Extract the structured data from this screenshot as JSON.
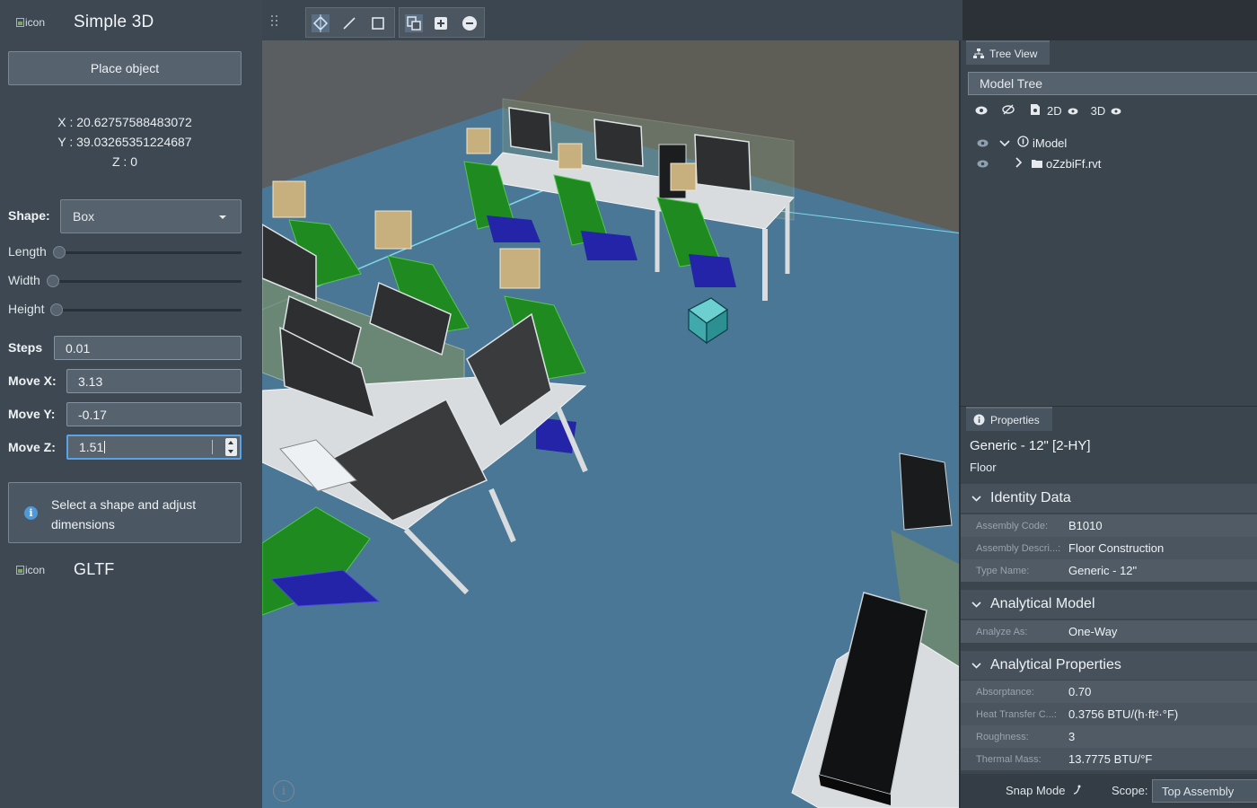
{
  "app": {
    "broken_image_alt": "icon",
    "title": "Simple 3D",
    "gltf_title": "GLTF"
  },
  "left": {
    "place_button": "Place object",
    "coords": {
      "x": "X : 20.62757588483072",
      "y": "Y : 39.03265351224687",
      "z": "Z : 0"
    },
    "shape_label": "Shape:",
    "shape_value": "Box",
    "sliders": [
      {
        "label": "Length",
        "value_fraction": 0
      },
      {
        "label": "Width",
        "value_fraction": 0
      },
      {
        "label": "Height",
        "value_fraction": 0
      }
    ],
    "steps_label": "Steps",
    "steps_value": "0.01",
    "move_x_label": "Move X:",
    "move_x_value": "3.13",
    "move_y_label": "Move Y:",
    "move_y_value": "-0.17",
    "move_z_label": "Move Z:",
    "move_z_value": "1.51",
    "info_message": "Select a shape and adjust dimensions"
  },
  "toolbar": {
    "tools": [
      "select-tool-icon",
      "measure-line-icon",
      "rectangle-icon",
      "copy-icon",
      "add-icon",
      "remove-icon"
    ]
  },
  "right": {
    "tree_tab": "Tree View",
    "model_tree_select": "Model Tree",
    "tree_tools": {
      "label_2d": "2D",
      "label_3d": "3D"
    },
    "tree_items": [
      {
        "label": "iModel"
      },
      {
        "label": "oZzbiFf.rvt"
      }
    ],
    "properties_tab": "Properties",
    "element_title": "Generic - 12\" [2-HY]",
    "element_class": "Floor",
    "sections": {
      "identity": {
        "title": "Identity Data",
        "rows": [
          {
            "key": "Assembly Code:",
            "value": "B1010"
          },
          {
            "key": "Assembly Descri...:",
            "value": "Floor Construction"
          },
          {
            "key": "Type Name:",
            "value": "Generic - 12\""
          }
        ]
      },
      "analytical_model": {
        "title": "Analytical Model",
        "rows": [
          {
            "key": "Analyze As:",
            "value": "One-Way"
          }
        ]
      },
      "analytical_properties": {
        "title": "Analytical Properties",
        "rows": [
          {
            "key": "Absorptance:",
            "value": "0.70"
          },
          {
            "key": "Heat Transfer C...:",
            "value": "0.3756 BTU/(h·ft²·°F)"
          },
          {
            "key": "Roughness:",
            "value": "3"
          },
          {
            "key": "Thermal Mass:",
            "value": "13.7775 BTU/°F"
          }
        ]
      }
    },
    "status": {
      "snap_mode": "Snap Mode",
      "scope_label": "Scope:",
      "scope_value": "Top Assembly"
    }
  },
  "colors": {
    "accent": "#5aa3e6",
    "floor": "#4a7796",
    "chair": "#1f8a1f",
    "pants": "#2424a8"
  }
}
